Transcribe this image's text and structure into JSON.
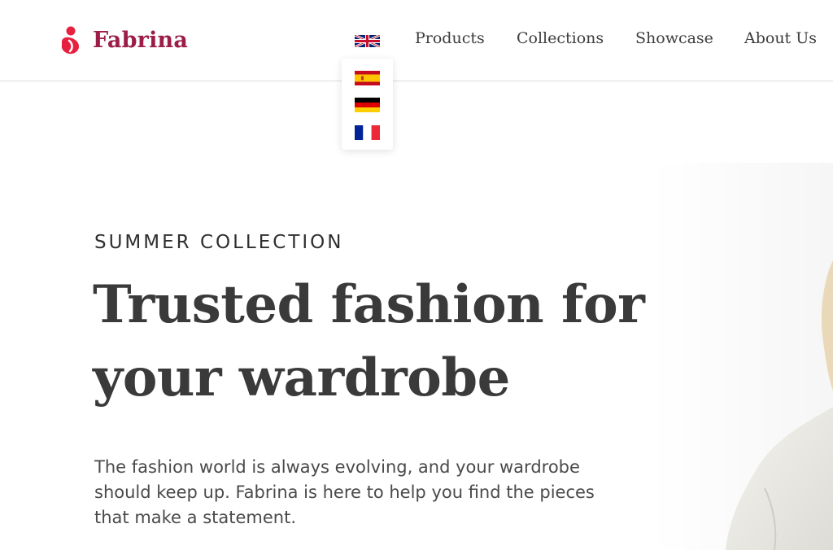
{
  "brand": {
    "name": "Fabrina",
    "color": "#9b1d48",
    "accent_color": "#e8203f"
  },
  "language_switcher": {
    "current": "en-gb-flag-icon",
    "options": [
      "es-flag-icon",
      "de-flag-icon",
      "fr-flag-icon"
    ]
  },
  "nav": {
    "items": [
      "Products",
      "Collections",
      "Showcase",
      "About Us"
    ]
  },
  "hero": {
    "eyebrow": "SUMMER  COLLECTION",
    "headline": "Trusted fashion for your wardrobe",
    "description": "The fashion world is always evolving, and your wardrobe should keep up. Fabrina is here to help you find the pieces that make a statement.",
    "image": "model-photo"
  }
}
